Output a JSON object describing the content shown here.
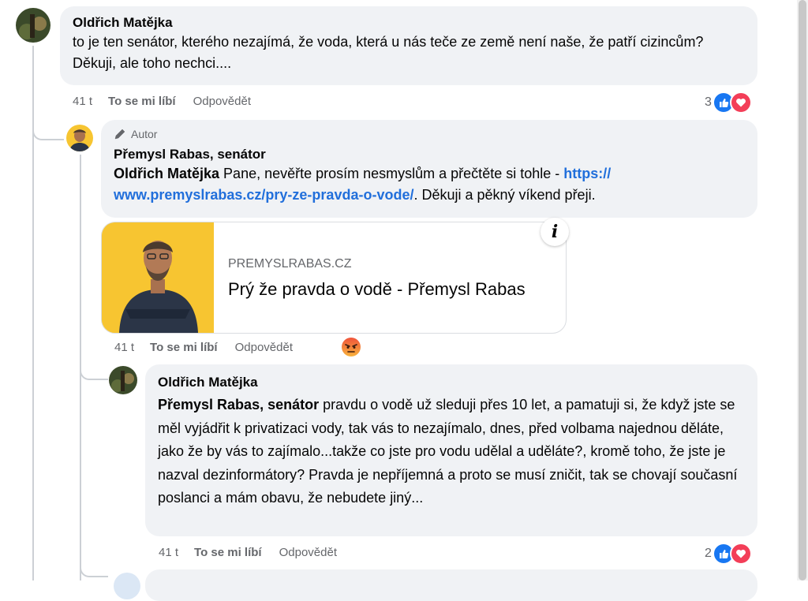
{
  "comments": [
    {
      "author": "Oldřich Matějka",
      "text": "to je ten senátor, kterého nezajímá, že voda, která u nás teče ze země není naše, že patří cizincům? Děkuji, ale toho nechci....",
      "time": "41 t",
      "like_label": "To se mi líbí",
      "reply_label": "Odpovědět",
      "reaction_count": "3"
    }
  ],
  "reply": {
    "badge": "Autor",
    "author": "Přemysl Rabas, senátor",
    "mention": "Oldřich Matějka",
    "text_before": " Pane, nevěřte prosím nesmyslům a přečtěte si tohle - ",
    "link_line1": "https://",
    "link_line2": "www.premyslrabas.cz/pry-ze-pravda-o-vode/",
    "text_after": ". Děkuji a pěkný víkend přeji.",
    "time": "41 t",
    "like_label": "To se mi líbí",
    "reply_label": "Odpovědět",
    "reaction": "angry-icon",
    "card": {
      "domain": "PREMYSLRABAS.CZ",
      "title": "Prý že pravda o vodě - Přemysl Rabas",
      "info_label": "i"
    }
  },
  "reply2": {
    "author": "Oldřich Matějka",
    "mention": "Přemysl Rabas, senátor",
    "text": " pravdu o vodě už sleduji přes 10 let, a pamatuji si, že když jste se měl vyjádřit k privatizaci vody, tak vás to nezajímalo, dnes, před volbama najednou děláte, jako že by vás to zajímalo...takže co jste pro vodu udělal a uděláte?, kromě toho, že jste je nazval dezinformátory? Pravda je nepříjemná a proto se musí zničit, tak se chovají současní poslanci a mám obavu, že nebudete jiný...",
    "time": "41 t",
    "like_label": "To se mi líbí",
    "reply_label": "Odpovědět",
    "reaction_count": "2"
  },
  "colors": {
    "bubble": "#f0f2f5",
    "link": "#216fdb",
    "like_blue": "#1877f2",
    "love_red": "#f33e58",
    "card_yellow": "#f7c531"
  }
}
